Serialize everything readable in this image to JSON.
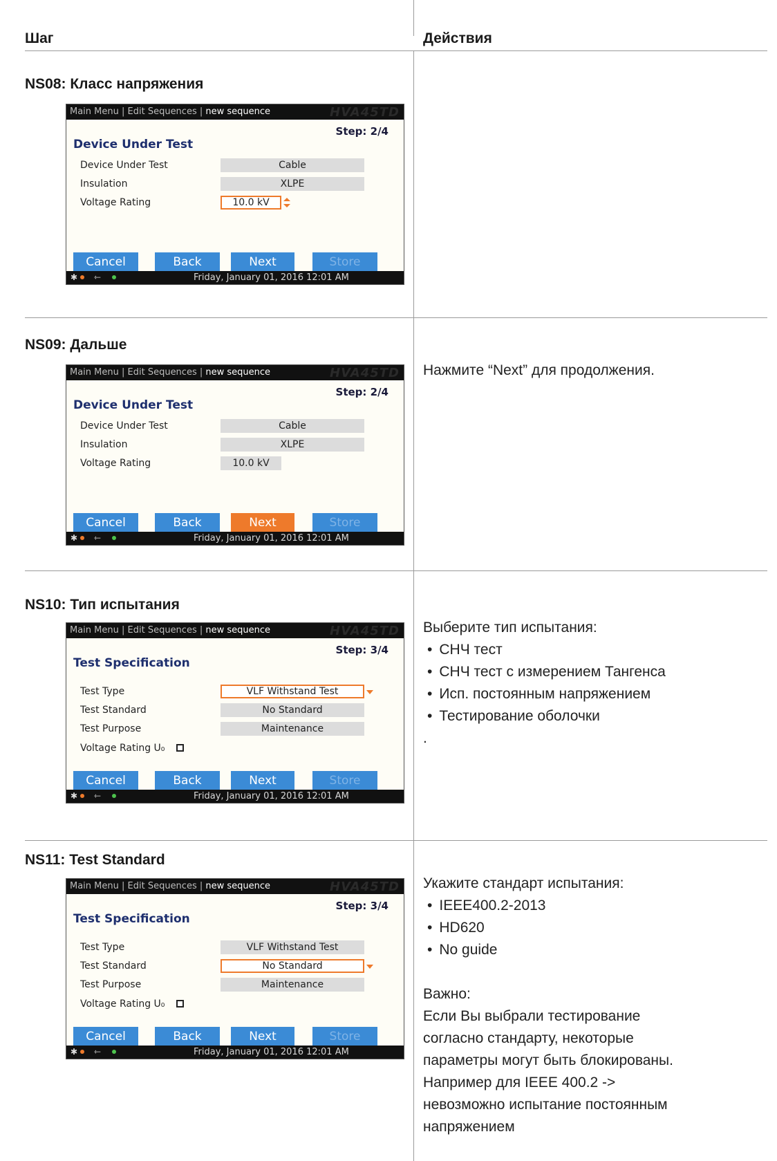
{
  "headers": {
    "step": "Шаг",
    "actions": "Действия"
  },
  "steps": [
    {
      "title": "NS08: Класс напряжения",
      "screen": {
        "crumbs": [
          "Main Menu",
          "Edit Sequences",
          "new sequence"
        ],
        "brand": "HVA45TD",
        "step": "Step: 2/4",
        "title": "Device Under Test",
        "fields": [
          {
            "label": "Device Under Test",
            "value": "Cable"
          },
          {
            "label": "Insulation",
            "value": "XLPE"
          },
          {
            "label": "Voltage Rating",
            "value": "10.0 kV"
          }
        ],
        "buttons": [
          "Cancel",
          "Back",
          "Next",
          "Store"
        ],
        "footer": "Friday, January 01, 2016 12:01 AM"
      },
      "action": ""
    },
    {
      "title": "NS09: Дальше",
      "screen": {
        "crumbs": [
          "Main Menu",
          "Edit Sequences",
          "new sequence"
        ],
        "brand": "HVA45TD",
        "step": "Step: 2/4",
        "title": "Device Under Test",
        "fields": [
          {
            "label": "Device Under Test",
            "value": "Cable"
          },
          {
            "label": "Insulation",
            "value": "XLPE"
          },
          {
            "label": "Voltage Rating",
            "value": "10.0 kV"
          }
        ],
        "buttons": [
          "Cancel",
          "Back",
          "Next",
          "Store"
        ],
        "footer": "Friday, January 01, 2016 12:01 AM"
      },
      "action": "Нажмите “Next” для продолжения."
    },
    {
      "title": "NS10: Тип испытания",
      "screen": {
        "crumbs": [
          "Main Menu",
          "Edit Sequences",
          "new sequence"
        ],
        "brand": "HVA45TD",
        "step": "Step: 3/4",
        "title": "Test Specification",
        "fields": [
          {
            "label": "Test Type",
            "value": "VLF Withstand Test"
          },
          {
            "label": "Test Standard",
            "value": "No Standard"
          },
          {
            "label": "Test Purpose",
            "value": "Maintenance"
          },
          {
            "label": "Voltage Rating U₀",
            "value": ""
          }
        ],
        "buttons": [
          "Cancel",
          "Back",
          "Next",
          "Store"
        ],
        "footer": "Friday, January 01, 2016 12:01 AM"
      },
      "action_intro": "Выберите тип испытания:",
      "action_items": [
        "СНЧ тест",
        "СНЧ тест с измерением Тангенса",
        "Исп. постоянным напряжением",
        "Тестирование оболочки"
      ],
      "action_tail": "."
    },
    {
      "title": "NS11: Test Standard",
      "screen": {
        "crumbs": [
          "Main Menu",
          "Edit Sequences",
          "new sequence"
        ],
        "brand": "HVA45TD",
        "step": "Step: 3/4",
        "title": "Test Specification",
        "fields": [
          {
            "label": "Test Type",
            "value": "VLF Withstand Test"
          },
          {
            "label": "Test Standard",
            "value": "No Standard"
          },
          {
            "label": "Test Purpose",
            "value": "Maintenance"
          },
          {
            "label": "Voltage Rating U₀",
            "value": ""
          }
        ],
        "buttons": [
          "Cancel",
          "Back",
          "Next",
          "Store"
        ],
        "footer": "Friday, January 01, 2016 12:01 AM"
      },
      "action_intro": "Укажите стандарт испытания:",
      "action_items": [
        "IEEE400.2-2013",
        "HD620",
        "No guide"
      ],
      "note_title": "Важно:",
      "note_lines": [
        "Если Вы выбрали тестирование",
        "согласно стандарту, некоторые",
        "параметры могут быть блокированы.",
        "Например для  IEEE 400.2 ->",
        "невозможно испытание постоянным",
        "напряжением"
      ]
    }
  ]
}
